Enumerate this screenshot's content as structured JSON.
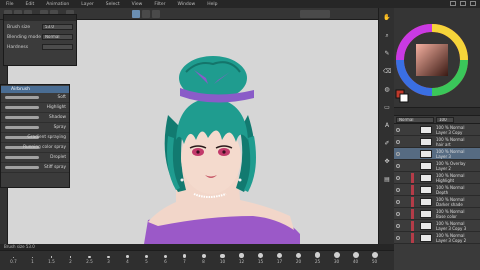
{
  "menu": [
    "File",
    "Edit",
    "Animation",
    "Layer",
    "Select",
    "View",
    "Filter",
    "Window",
    "Help"
  ],
  "tool_property": {
    "rows": [
      {
        "label": "Brush size",
        "value": "53.0"
      },
      {
        "label": "Blending mode",
        "value": "Normal"
      },
      {
        "label": "Hardness",
        "value": ""
      }
    ]
  },
  "brush_panel": {
    "tab": "Airbrush",
    "items": [
      "Soft",
      "Highlight",
      "Shadow",
      "Spray",
      "Gradient spraying",
      "Running color spray",
      "Droplet",
      "Stiff spray"
    ]
  },
  "right_icons": [
    "hand-icon",
    "zoom-icon",
    "pen-icon",
    "eraser-icon",
    "fill-icon",
    "select-icon",
    "text-icon",
    "brush-icon",
    "move-icon",
    "layer-icon"
  ],
  "layers": {
    "blend_mode": "Normal",
    "opacity": "100",
    "items": [
      {
        "top": "100 % Normal",
        "name": "Layer 3 Copy",
        "selected": false
      },
      {
        "top": "100 % Normal",
        "name": "hair art",
        "selected": false
      },
      {
        "top": "100 % Normal",
        "name": "Layer 3",
        "selected": true
      },
      {
        "top": "100 % Overlay",
        "name": "Layer 2",
        "selected": false
      },
      {
        "top": "100 % Normal",
        "name": "Highlight",
        "selected": false
      },
      {
        "top": "100 % Normal",
        "name": "Depth",
        "selected": false
      },
      {
        "top": "100 % Normal",
        "name": "Darker shade",
        "selected": false
      },
      {
        "top": "100 % Normal",
        "name": "Base color",
        "selected": false
      },
      {
        "top": "100 % Normal",
        "name": "Layer 3 Copy 3",
        "selected": false
      },
      {
        "top": "100 % Normal",
        "name": "Layer 3 Copy 2",
        "selected": false
      }
    ]
  },
  "brush_sizes": [
    "0.7",
    "1",
    "1.5",
    "2",
    "2.5",
    "3",
    "4",
    "5",
    "6",
    "7",
    "8",
    "10",
    "12",
    "15",
    "17",
    "20",
    "25",
    "30",
    "40",
    "50"
  ],
  "status": "Brush size 53.0",
  "colors": {
    "hair": "#1f9c8f",
    "bow": "#8a5cc8",
    "dress": "#9b59c8",
    "skin": "#f2d6c9",
    "accent": "#6b8fb3"
  }
}
